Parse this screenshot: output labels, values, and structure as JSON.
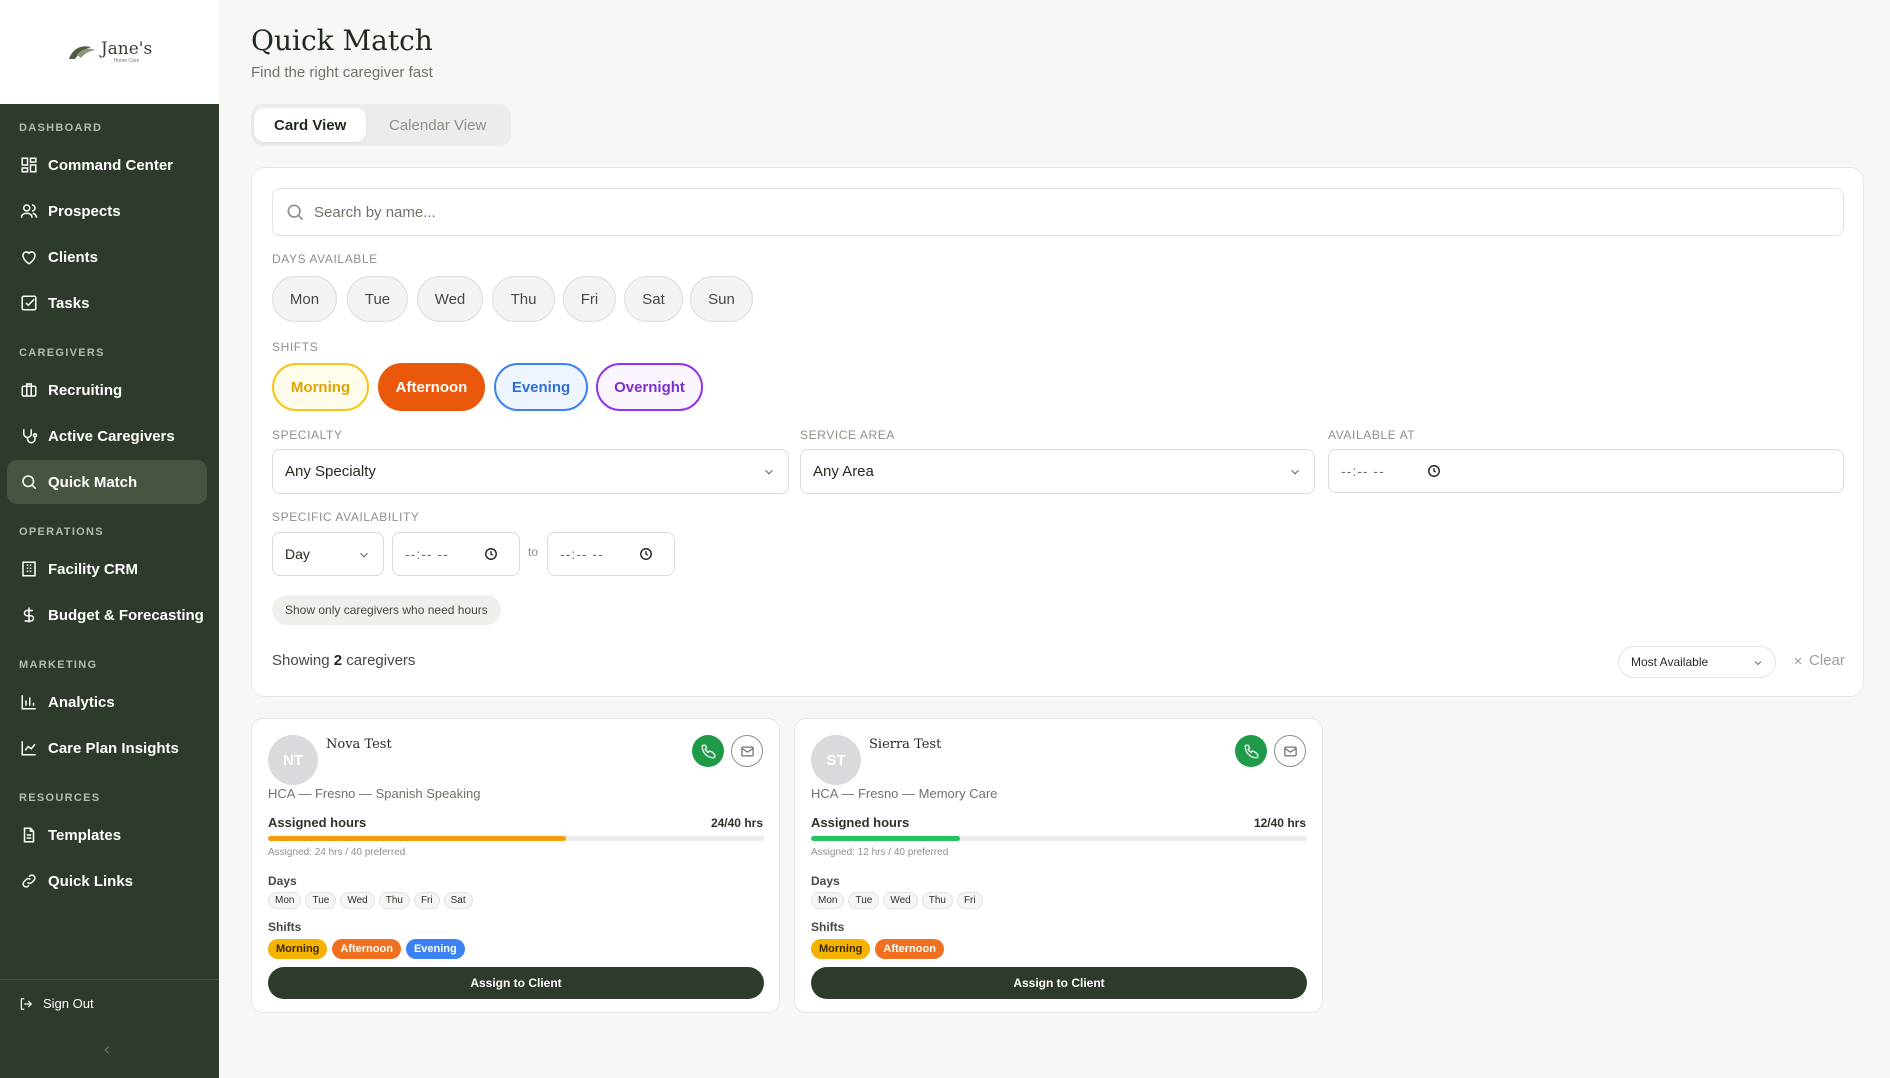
{
  "brand": {
    "name": "Jane's",
    "tagline": "Home Care"
  },
  "sidebar": {
    "sections": [
      {
        "label": "DASHBOARD"
      },
      {
        "label": "CAREGIVERS"
      },
      {
        "label": "OPERATIONS"
      },
      {
        "label": "MARKETING"
      },
      {
        "label": "RESOURCES"
      }
    ],
    "items": [
      {
        "label": "Command Center",
        "icon": "grid-icon"
      },
      {
        "label": "Prospects",
        "icon": "users-icon"
      },
      {
        "label": "Clients",
        "icon": "heart-icon"
      },
      {
        "label": "Tasks",
        "icon": "checkbox-icon"
      },
      {
        "label": "Recruiting",
        "icon": "briefcase-icon"
      },
      {
        "label": "Active Caregivers",
        "icon": "stethoscope-icon"
      },
      {
        "label": "Quick Match",
        "icon": "search-icon",
        "active": true
      },
      {
        "label": "Facility CRM",
        "icon": "building-icon"
      },
      {
        "label": "Budget & Forecasting",
        "icon": "dollar-icon"
      },
      {
        "label": "Analytics",
        "icon": "bar-chart-icon"
      },
      {
        "label": "Care Plan Insights",
        "icon": "line-chart-icon"
      },
      {
        "label": "Templates",
        "icon": "file-icon"
      },
      {
        "label": "Quick Links",
        "icon": "link-icon"
      }
    ],
    "sign_out": "Sign Out"
  },
  "page": {
    "title": "Quick Match",
    "subtitle": "Find the right caregiver fast"
  },
  "tabs": [
    {
      "label": "Card View",
      "active": true
    },
    {
      "label": "Calendar View",
      "active": false
    }
  ],
  "filters": {
    "search_placeholder": "Search by name...",
    "days_label": "DAYS AVAILABLE",
    "days": [
      "Mon",
      "Tue",
      "Wed",
      "Thu",
      "Fri",
      "Sat",
      "Sun"
    ],
    "shifts_label": "SHIFTS",
    "shifts": [
      {
        "label": "Morning",
        "selected": false,
        "color": "#f2b705"
      },
      {
        "label": "Afternoon",
        "selected": true,
        "color": "#ea580c"
      },
      {
        "label": "Evening",
        "selected": false,
        "color": "#3b82f6"
      },
      {
        "label": "Overnight",
        "selected": false,
        "color": "#9333ea"
      }
    ],
    "specialty_label": "SPECIALTY",
    "specialty_value": "Any Specialty",
    "service_area_label": "SERVICE AREA",
    "service_area_value": "Any Area",
    "available_at_label": "AVAILABLE AT",
    "available_at_value": "--:-- --",
    "specific_label": "SPECIFIC AVAILABILITY",
    "specific_day": "Day",
    "specific_from": "--:-- --",
    "to_label": "to",
    "specific_to": "--:-- --",
    "need_hours_label": "Show only caregivers who need hours"
  },
  "results": {
    "showing_prefix": "Showing",
    "count": "2",
    "showing_suffix": "caregivers",
    "sort_value": "Most Available",
    "clear_label": "Clear"
  },
  "caregivers": [
    {
      "initials": "NT",
      "name": "Nova Test",
      "description": "HCA — Fresno — Spanish Speaking",
      "assigned_label": "Assigned hours",
      "assigned_value": "24/40 hrs",
      "assigned_fraction": 0.6,
      "bar_color": "#f59e0b",
      "note": "Assigned: 24 hrs / 40 preferred",
      "days_label": "Days",
      "days": [
        "Mon",
        "Tue",
        "Wed",
        "Thu",
        "Fri",
        "Sat"
      ],
      "shifts_label": "Shifts",
      "shifts": [
        "Morning",
        "Afternoon",
        "Evening"
      ],
      "assign_label": "Assign to Client"
    },
    {
      "initials": "ST",
      "name": "Sierra Test",
      "description": "HCA — Fresno — Memory Care",
      "assigned_label": "Assigned hours",
      "assigned_value": "12/40 hrs",
      "assigned_fraction": 0.3,
      "bar_color": "#22c55e",
      "note": "Assigned: 12 hrs / 40 preferred",
      "days_label": "Days",
      "days": [
        "Mon",
        "Tue",
        "Wed",
        "Thu",
        "Fri"
      ],
      "shifts_label": "Shifts",
      "shifts": [
        "Morning",
        "Afternoon"
      ],
      "assign_label": "Assign to Client"
    }
  ],
  "colors": {
    "sidebar_bg": "#2e3a2b",
    "morning": "#f5b300",
    "afternoon": "#f0701f",
    "evening": "#3b82f6",
    "primary_button": "#2e3a2b"
  }
}
